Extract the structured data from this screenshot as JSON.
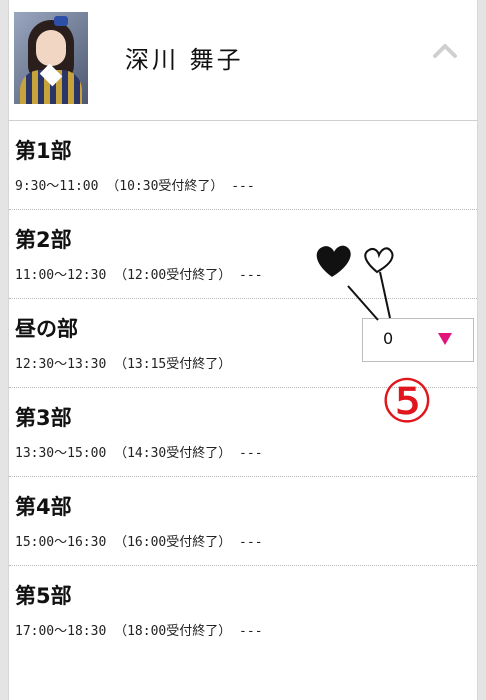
{
  "header": {
    "member_name": "深川 舞子",
    "collapse_icon": "chevron-up-icon",
    "avatar": "member-photo"
  },
  "sessions": [
    {
      "part": "第1部",
      "time": "9:30～11:00 （10:30受付終了） ---"
    },
    {
      "part": "第2部",
      "time": "11:00～12:30 （12:00受付終了） ---"
    },
    {
      "part": "昼の部",
      "time": "12:30～13:30 （13:15受付終了）"
    },
    {
      "part": "第3部",
      "time": "13:30～15:00 （14:30受付終了） ---"
    },
    {
      "part": "第4部",
      "time": "15:00～16:30 （16:00受付終了） ---"
    },
    {
      "part": "第5部",
      "time": "17:00～18:30 （18:00受付終了） ---"
    }
  ],
  "quantity_select": {
    "value": "0",
    "arrow_color": "#e0147a"
  },
  "annotation": {
    "number": "⑤",
    "color": "#e0161c",
    "icons": [
      "heart-filled-icon",
      "heart-outline-icon"
    ]
  }
}
